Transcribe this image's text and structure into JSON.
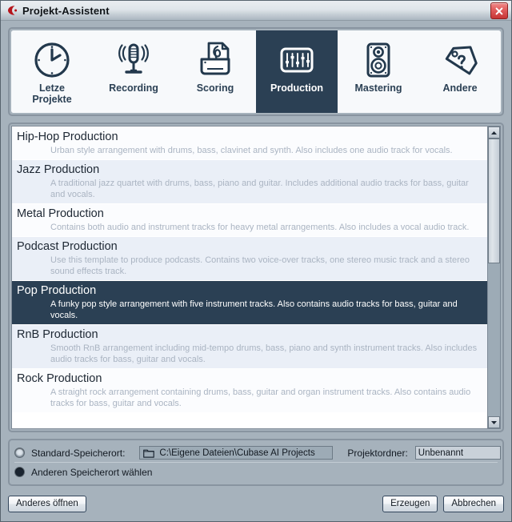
{
  "window": {
    "title": "Projekt-Assistent",
    "app_icon": "cubase-logo-icon",
    "close_icon": "close-icon"
  },
  "tabs": [
    {
      "label": "Letze\nProjekte",
      "label_line1": "Letze",
      "label_line2": "Projekte",
      "icon": "clock-icon",
      "active": false
    },
    {
      "label": "Recording",
      "icon": "microphone-icon",
      "active": false
    },
    {
      "label": "Scoring",
      "icon": "score-sheet-icon",
      "active": false
    },
    {
      "label": "Production",
      "icon": "mixer-faders-icon",
      "active": true
    },
    {
      "label": "Mastering",
      "icon": "speaker-icon",
      "active": false
    },
    {
      "label": "Andere",
      "icon": "tag-question-icon",
      "active": false
    }
  ],
  "templates": [
    {
      "title": "Hip-Hop Production",
      "description": "Urban style arrangement with drums, bass, clavinet and synth. Also includes one audio track for vocals.",
      "selected": false,
      "shade": "plain"
    },
    {
      "title": "Jazz Production",
      "description": "A traditional jazz quartet with drums, bass, piano and guitar. Includes additional audio tracks for bass, guitar and vocals.",
      "selected": false,
      "shade": "alt"
    },
    {
      "title": "Metal Production",
      "description": "Contains both audio and instrument tracks for heavy metal arrangements. Also includes a vocal audio track.",
      "selected": false,
      "shade": "plain"
    },
    {
      "title": "Podcast Production",
      "description": "Use this template to produce podcasts. Contains two voice-over tracks, one stereo music track and a stereo sound effects track.",
      "selected": false,
      "shade": "alt"
    },
    {
      "title": "Pop Production",
      "description": "A funky pop style arrangement with five instrument tracks. Also contains audio tracks for bass, guitar and vocals.",
      "selected": true,
      "shade": "selected"
    },
    {
      "title": "RnB Production",
      "description": "Smooth RnB arrangement including mid-tempo drums, bass, piano and synth instrument tracks. Also includes audio tracks for bass, guitar and vocals.",
      "selected": false,
      "shade": "alt"
    },
    {
      "title": "Rock Production",
      "description": "A straight rock arrangement containing drums, bass, guitar and organ instrument tracks. Also contains audio tracks for bass, guitar and vocals.",
      "selected": false,
      "shade": "plain"
    }
  ],
  "scrollbar": {
    "up_icon": "chevron-up-icon",
    "down_icon": "chevron-down-icon",
    "thumb_position_percent": 0,
    "thumb_size_percent": 45
  },
  "storage": {
    "default_label": "Standard-Speicherort:",
    "default_selected": true,
    "other_label": "Anderen Speicherort wählen",
    "other_selected": false,
    "path_value": "C:\\Eigene Dateien\\Cubase AI Projects",
    "folder_icon": "folder-icon",
    "project_folder_label": "Projektordner:",
    "project_folder_value": "Unbenannt",
    "project_folder_placeholder": "Unbenannt"
  },
  "footer": {
    "open_other_label": "Anderes öffnen",
    "create_label": "Erzeugen",
    "cancel_label": "Abbrechen"
  },
  "colors": {
    "accent_dark": "#2b4054",
    "panel_bg": "#a6b2bc",
    "list_alt": "#eaeff7",
    "list_plain": "#fbfcfe",
    "desc_text": "#aab4c2"
  }
}
